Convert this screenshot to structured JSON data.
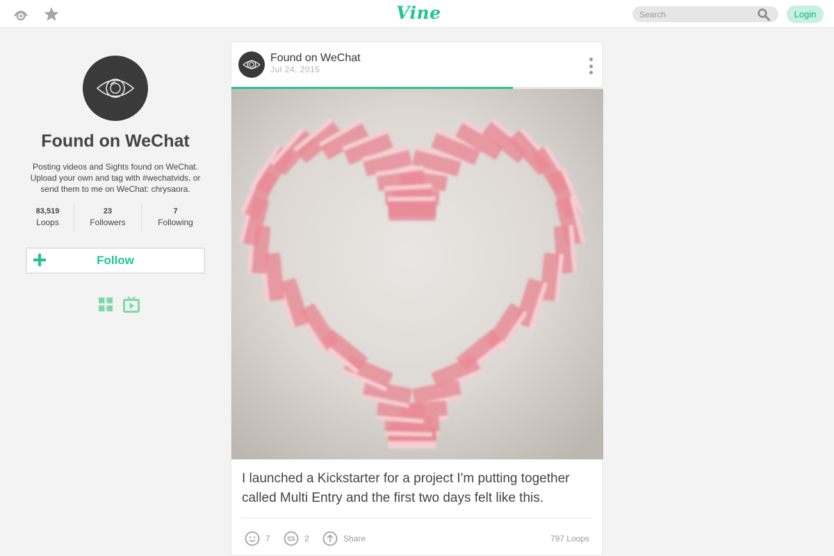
{
  "topbar": {
    "logo": "Vine",
    "search_placeholder": "Search",
    "login_label": "Login",
    "icons": [
      "popular-eye-icon",
      "star-icon",
      "search-icon"
    ]
  },
  "profile": {
    "name": "Found on WeChat",
    "bio": "Posting videos and Sights found on WeChat. Upload your own and tag with #wechatvids, or send them to me on WeChat: chrysaora.",
    "stats": [
      {
        "value": "83,519",
        "label": "Loops"
      },
      {
        "value": "23",
        "label": "Followers"
      },
      {
        "value": "7",
        "label": "Following"
      }
    ],
    "follow_label": "Follow",
    "view_icons": [
      "grid-view-icon",
      "tv-view-icon"
    ]
  },
  "post": {
    "author": "Found on WeChat",
    "date": "Jul 24, 2015",
    "progress": 0.76,
    "caption": "I launched a Kickstarter for a project I'm putting together called Multi Entry and the first two days felt like this.",
    "likes": "7",
    "revines": "2",
    "share_label": "Share",
    "loops": "797 Loops"
  },
  "colors": {
    "brand": "#1fc591",
    "login_bg": "#c7f0e3",
    "banknote": "#e98b97"
  }
}
